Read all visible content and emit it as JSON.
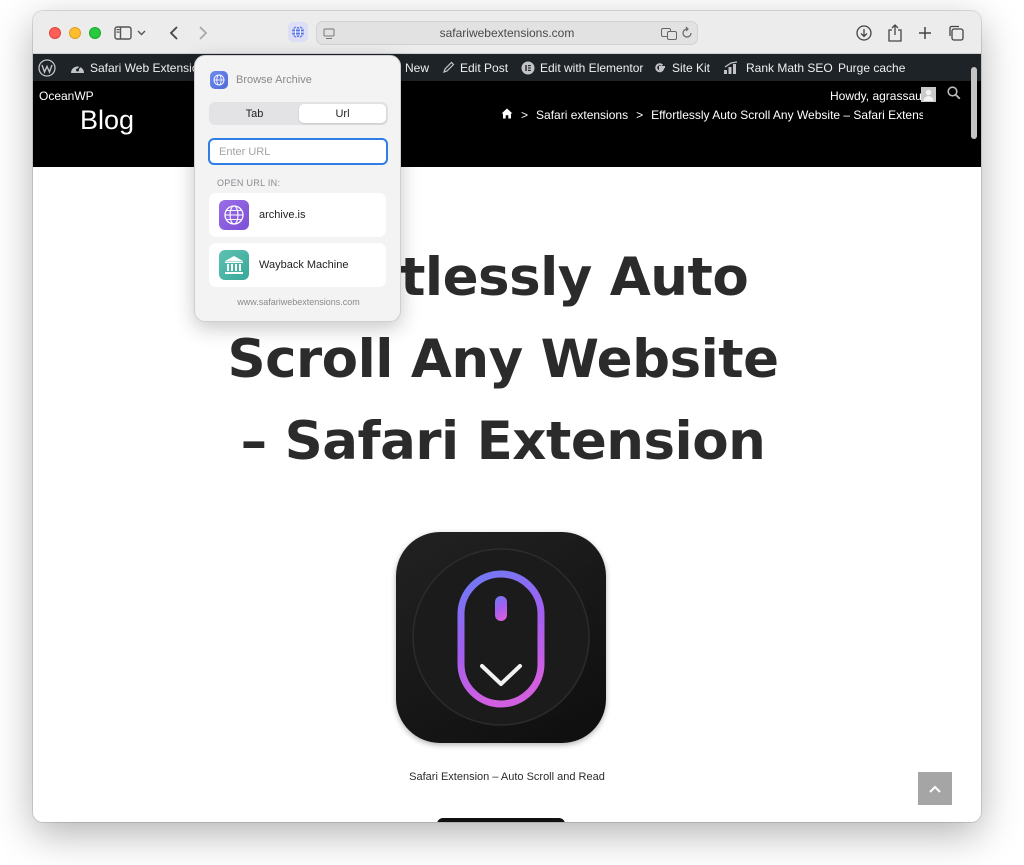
{
  "browser": {
    "address": "safariwebextensions.com"
  },
  "wp_admin_bar": {
    "site_name": "Safari Web Extensions",
    "new_label": "New",
    "edit_post": "Edit Post",
    "edit_elementor": "Edit with Elementor",
    "site_kit": "Site Kit",
    "rank_math": "Rank Math SEO",
    "purge_cache": "Purge cache"
  },
  "site_header": {
    "theme_name": "OceanWP",
    "howdy": "Howdy, agrassau",
    "title": "Blog",
    "breadcrumb": [
      "Safari extensions",
      "Effortlessly Auto Scroll Any Website – Safari Extension"
    ]
  },
  "post": {
    "title_lines": [
      "Effortlessly Auto",
      "Scroll Any Website",
      "– Safari Extension"
    ],
    "image_caption": "Safari Extension – Auto Scroll and Read"
  },
  "popover": {
    "title": "Browse Archive",
    "tabs": [
      "Tab",
      "Url"
    ],
    "selected_tab": "Url",
    "url_placeholder": "Enter URL",
    "url_value": "",
    "open_in_label": "OPEN URL IN:",
    "services": [
      {
        "name": "archive.is",
        "icon": "globe-icon",
        "color": "#8b5cf6"
      },
      {
        "name": "Wayback Machine",
        "icon": "museum-icon",
        "color": "#4db6a8"
      }
    ],
    "footer": "www.safariwebextensions.com"
  }
}
